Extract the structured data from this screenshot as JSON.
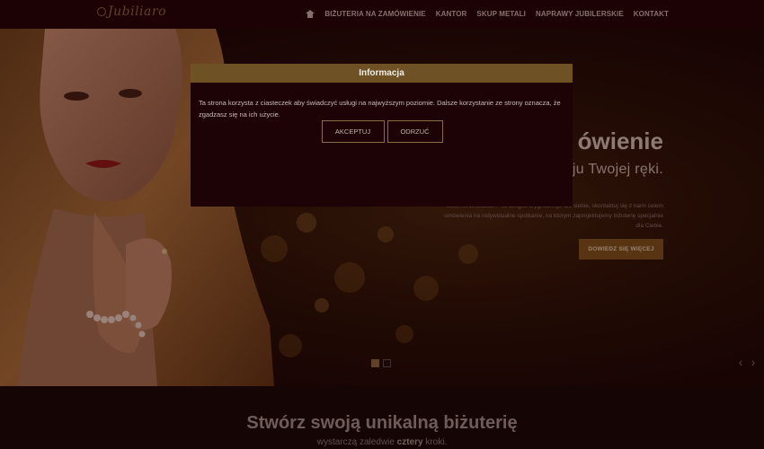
{
  "nav": {
    "logo": "Jubiliaro",
    "items": [
      {
        "label": "BIŻUTERIA NA ZAMÓWIENIE"
      },
      {
        "label": "KANTOR"
      },
      {
        "label": "SKUP METALI"
      },
      {
        "label": "NAPRAWY JUBILERSKIE"
      },
      {
        "label": "KONTAKT"
      }
    ],
    "home_icon": "home-icon"
  },
  "hero": {
    "title": "ówienie",
    "subtitle": "ju Twojej ręki.",
    "description": "Jeśli nie znalazłaś / -eś czegoś oryginalnego dla siebie, skontaktuj się z nami celem umówienia na indywidualne spotkanie, na którym zaprojektujemy biżuterię specjalnie dla Ciebie.",
    "button": "DOWIEDZ SIĘ WIĘCEJ",
    "slides": 2,
    "active_slide": 1,
    "prev_icon": "chevron-left-icon",
    "next_icon": "chevron-right-icon"
  },
  "section": {
    "title": "Stwórz swoją unikalną biżuterię",
    "subtitle_before": "wystarczą zaledwie ",
    "subtitle_bold": "cztery",
    "subtitle_after": " kroki."
  },
  "modal": {
    "title": "Informacja",
    "text": "Ta strona korzysta z ciasteczek aby świadczyć usługi na najwyższym poziomie. Dalsze korzystanie ze strony oznacza, że zgadzasz się na ich użycie.",
    "accept": "AKCEPTUJ",
    "decline": "ODRZUĆ"
  },
  "colors": {
    "nav_bg": "#140408",
    "accent_gold": "#6e5226",
    "overlay": "#280000",
    "modal_bg": "#1e0306"
  }
}
